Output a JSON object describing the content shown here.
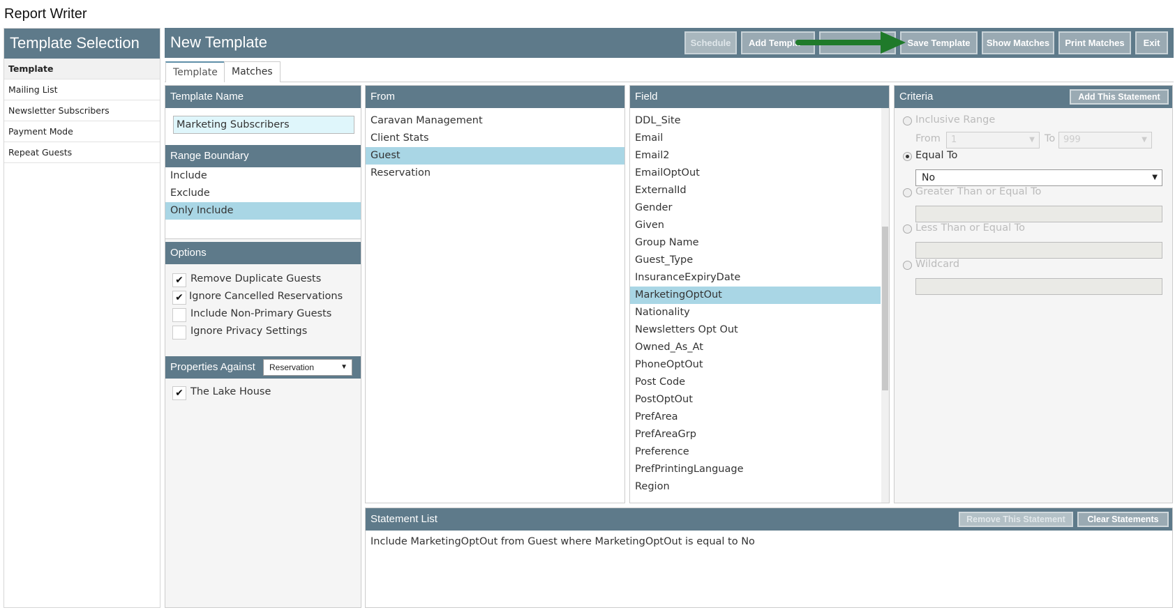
{
  "app": {
    "title": "Report Writer"
  },
  "sidebar": {
    "title": "Template Selection",
    "items": [
      {
        "label": "Template",
        "active": true
      },
      {
        "label": "Mailing List"
      },
      {
        "label": "Newsletter Subscribers"
      },
      {
        "label": "Payment Mode"
      },
      {
        "label": "Repeat Guests"
      }
    ]
  },
  "header": {
    "title": "New Template",
    "buttons": {
      "schedule": "Schedule",
      "add_template": "Add Templa",
      "save_template": "Save Template",
      "show_matches": "Show Matches",
      "print_matches": "Print Matches",
      "exit": "Exit"
    }
  },
  "tabs": {
    "template": "Template",
    "matches": "Matches"
  },
  "template_name": {
    "heading": "Template Name",
    "value": "Marketing Subscribers"
  },
  "range_boundary": {
    "heading": "Range Boundary",
    "items": [
      "Include",
      "Exclude",
      "Only Include"
    ],
    "selected": "Only Include"
  },
  "options": {
    "heading": "Options",
    "items": [
      {
        "label": "Remove Duplicate Guests",
        "checked": true
      },
      {
        "label": "Ignore Cancelled Reservations",
        "checked": true
      },
      {
        "label": "Include Non-Primary Guests",
        "checked": false
      },
      {
        "label": "Ignore Privacy Settings",
        "checked": false
      }
    ]
  },
  "properties": {
    "heading": "Properties Against",
    "select_value": "Reservation",
    "items": [
      {
        "label": "The Lake House",
        "checked": true
      }
    ]
  },
  "from": {
    "heading": "From",
    "items": [
      "Caravan Management",
      "Client Stats",
      "Guest",
      "Reservation"
    ],
    "selected": "Guest"
  },
  "field": {
    "heading": "Field",
    "items": [
      "DDL_Site",
      "Email",
      "Email2",
      "EmailOptOut",
      "ExternalId",
      "Gender",
      "Given",
      "Group Name",
      "Guest_Type",
      "InsuranceExpiryDate",
      "MarketingOptOut",
      "Nationality",
      "Newsletters Opt Out",
      "Owned_As_At",
      "PhoneOptOut",
      "Post Code",
      "PostOptOut",
      "PrefArea",
      "PrefAreaGrp",
      "Preference",
      "PrefPrintingLanguage",
      "Region"
    ],
    "selected": "MarketingOptOut"
  },
  "criteria": {
    "heading": "Criteria",
    "add_button": "Add This Statement",
    "inclusive_range": "Inclusive Range",
    "from_label": "From",
    "from_value": "1",
    "to_label": "To",
    "to_value": "999",
    "equal_to": "Equal To",
    "equal_value": "No",
    "greater": "Greater Than or Equal To",
    "less": "Less Than or Equal To",
    "wildcard": "Wildcard"
  },
  "statement_list": {
    "heading": "Statement List",
    "remove_button": "Remove This Statement",
    "clear_button": "Clear Statements",
    "statements": [
      "Include MarketingOptOut from Guest where MarketingOptOut is equal to No"
    ]
  },
  "colors": {
    "header": "#5e7a8a",
    "selected": "#a9d6e5",
    "arrow": "#1f7a2a"
  }
}
